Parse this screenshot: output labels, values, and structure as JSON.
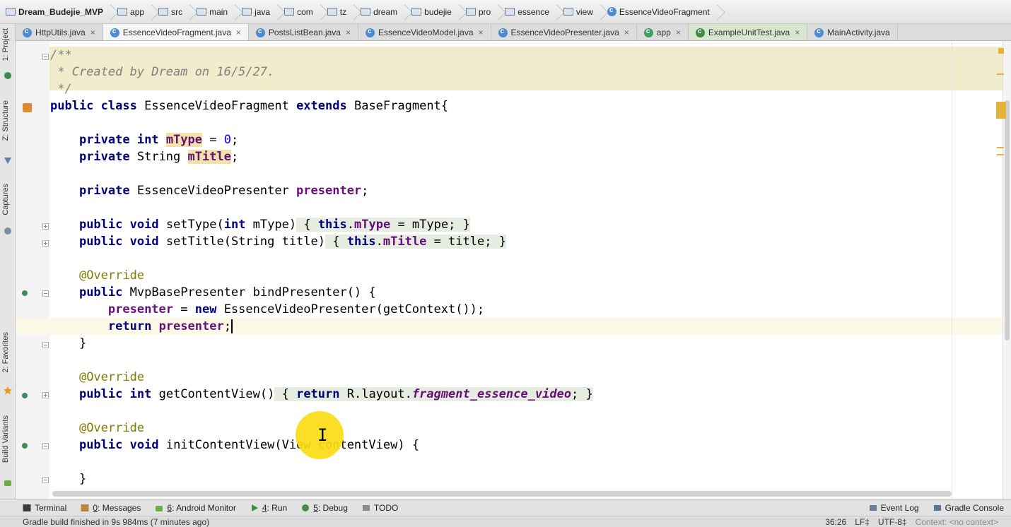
{
  "breadcrumbs": [
    "Dream_Budejie_MVP",
    "app",
    "src",
    "main",
    "java",
    "com",
    "tz",
    "dream",
    "budejie",
    "pro",
    "essence",
    "view",
    "EssenceVideoFragment"
  ],
  "tabs": [
    {
      "label": "HttpUtils.java"
    },
    {
      "label": "EssenceVideoFragment.java"
    },
    {
      "label": "PostsListBean.java"
    },
    {
      "label": "EssenceVideoModel.java"
    },
    {
      "label": "EssenceVideoPresenter.java"
    },
    {
      "label": "app"
    },
    {
      "label": "ExampleUnitTest.java"
    },
    {
      "label": "MainActivity.java"
    }
  ],
  "tab_close_glyph": "×",
  "left_tools": {
    "project": "1: Project",
    "structure": "Z: Structure",
    "captures": "Captures",
    "favorites": "2: Favorites",
    "build_variants": "Build Variants"
  },
  "code": {
    "doc1": "/**",
    "doc2": " * Created by Dream on 16/5/27.",
    "doc3": " */",
    "l_public": "public",
    "l_class": "class",
    "l_classname": "EssenceVideoFragment",
    "l_extends": "extends",
    "l_base": "BaseFragment{",
    "private": "private",
    "int": "int",
    "mType": "mType",
    "eq0": " = ",
    "zero": "0",
    "semi": ";",
    "String": "String",
    "mTitle": "mTitle",
    "presenterType": "EssenceVideoPresenter",
    "presenter": "presenter",
    "public": "public",
    "void": "void",
    "setType": "setType(",
    "intParam": "int",
    "mTypeParam": " mType)",
    "openBrace": " { ",
    "this": "this",
    "dot": ".",
    "assignMType": " = mType; ",
    "closeBrace": "}",
    "setTitle": "setTitle(String title)",
    "assignTitle": " = title; ",
    "override": "@Override",
    "mvpType": "MvpBasePresenter",
    "bindPresenter": "bindPresenter() {",
    "assignEq": " = ",
    "new": "new",
    "newExpr": " EssenceVideoPresenter(getContext());",
    "return": "return",
    "brace": "}",
    "getContentView": "getContentView()",
    "rlayout": " R.layout.",
    "fragmentRes": "fragment_essence_video",
    "semiSp": "; ",
    "initContentView": "initContentView(View contentView) {",
    "ibeam": "I"
  },
  "bottom_tools": [
    {
      "num": "",
      "label": "Terminal"
    },
    {
      "num": "0",
      "label": ": Messages"
    },
    {
      "num": "6",
      "label": ": Android Monitor"
    },
    {
      "num": "4",
      "label": ": Run"
    },
    {
      "num": "5",
      "label": ": Debug"
    },
    {
      "num": "",
      "label": "TODO"
    }
  ],
  "bottom_right": [
    "Event Log",
    "Gradle Console"
  ],
  "status": {
    "message": "Gradle build finished in 9s 984ms (7 minutes ago)",
    "position": "36:26",
    "line_sep": "LF‡",
    "encoding": "UTF-8‡",
    "context": "Context: <no context>"
  },
  "colors": {
    "keyword": "#000080",
    "field": "#660e7a",
    "annotation": "#808000",
    "comment": "#808080",
    "number": "#0000ff",
    "cursor_highlight": "#fadc14"
  }
}
